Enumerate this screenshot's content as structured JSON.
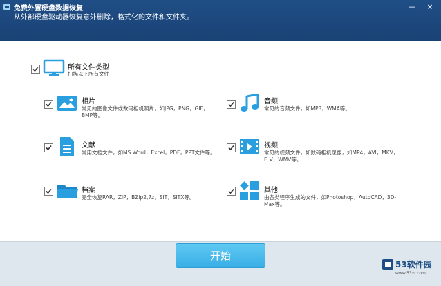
{
  "window": {
    "title": "免费外置硬盘数据恢复",
    "subtitle": "从外部硬盘驱动器恢复意外删除，格式化的文件和文件夹。",
    "minimize": "—",
    "close": "×"
  },
  "all_types": {
    "title": "所有文件类型",
    "desc": "扫描以下所有文件",
    "checked": true
  },
  "items": [
    {
      "title": "相片",
      "desc": "常见的图像文件或数码相机照片，如JPG，PNG，GIF，BMP等。",
      "icon": "photo-icon"
    },
    {
      "title": "音频",
      "desc": "常见的音频文件，如MP3，WMA等。",
      "icon": "music-note-icon"
    },
    {
      "title": "文献",
      "desc": "常用文档文件，如MS Word，Excel，PDF，PPT文件等。",
      "icon": "document-icon"
    },
    {
      "title": "视频",
      "desc": "常见的视频文件，如数码相机录像，如MP4，AVI，MKV，FLV，WMV等。",
      "icon": "film-icon"
    },
    {
      "title": "档案",
      "desc": "完全恢复RAR，ZIP，BZip2,7z，SIT，SITX等。",
      "icon": "folder-icon"
    },
    {
      "title": "其他",
      "desc": "由各类程序生成的文件，如Photoshop，AutoCAD，3D-Max等。",
      "icon": "other-apps-icon"
    }
  ],
  "footer": {
    "start_label": "开始"
  },
  "watermark": {
    "name": "53软件园",
    "url": "www.53xr.com"
  },
  "colors": {
    "header": "#1f4e86",
    "icon_blue": "#2a9fe0",
    "button": "#43b6ea",
    "footer": "#dfe7ee"
  }
}
